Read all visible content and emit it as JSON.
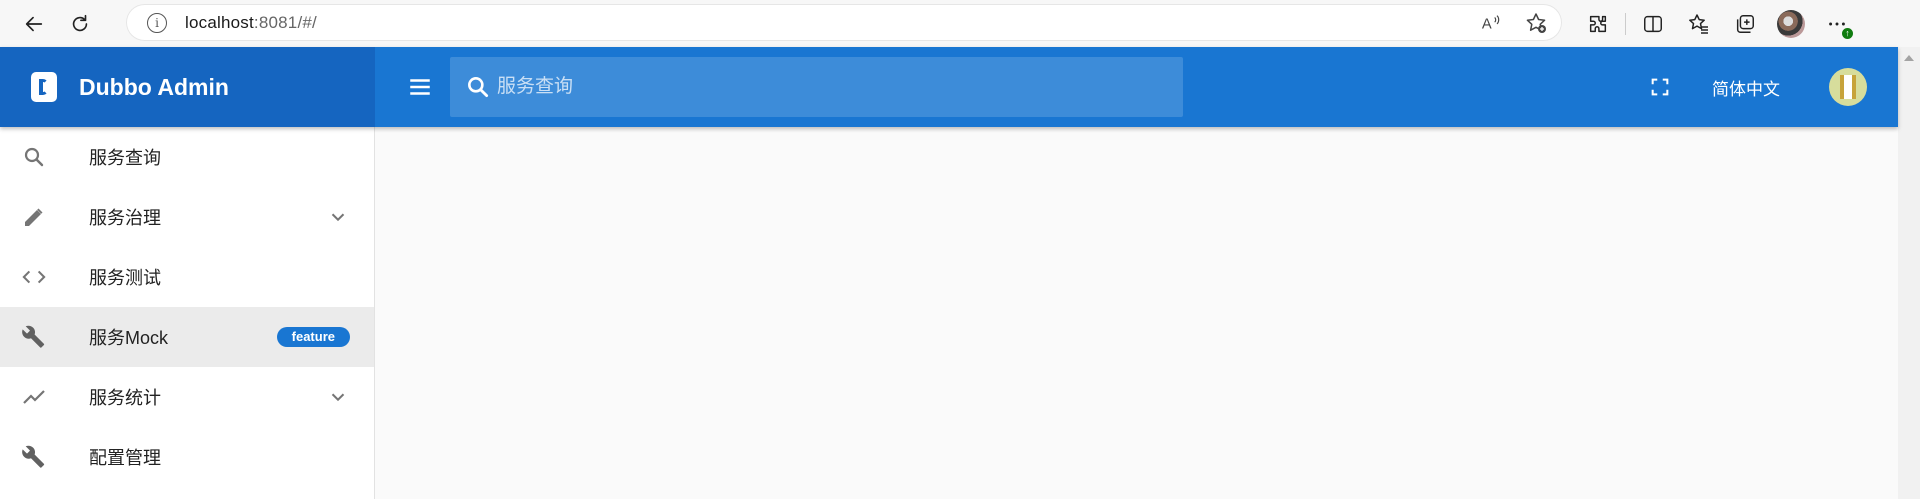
{
  "browser": {
    "url_host": "localhost",
    "url_rest": ":8081/#/",
    "icons": [
      "back-arrow-icon",
      "refresh-icon",
      "site-info-icon",
      "read-aloud-icon",
      "favorite-add-icon",
      "extensions-icon",
      "split-screen-icon",
      "favorites-icon",
      "collections-icon",
      "profile-avatar-icon",
      "more-icon"
    ],
    "more_badge": "↑"
  },
  "app": {
    "title": "Dubbo Admin",
    "search_placeholder": "服务查询",
    "language": "简体中文",
    "accent_color": "#1976d2",
    "brand_color": "#1565c0"
  },
  "sidebar": {
    "items": [
      {
        "label": "服务查询",
        "icon": "search-icon",
        "expandable": false
      },
      {
        "label": "服务治理",
        "icon": "pencil-icon",
        "expandable": true
      },
      {
        "label": "服务测试",
        "icon": "code-icon",
        "expandable": false
      },
      {
        "label": "服务Mock",
        "icon": "wrench-icon",
        "expandable": false,
        "badge": "feature",
        "active": true
      },
      {
        "label": "服务统计",
        "icon": "trending-up-icon",
        "expandable": true
      },
      {
        "label": "配置管理",
        "icon": "wrench-icon",
        "expandable": false
      }
    ]
  }
}
